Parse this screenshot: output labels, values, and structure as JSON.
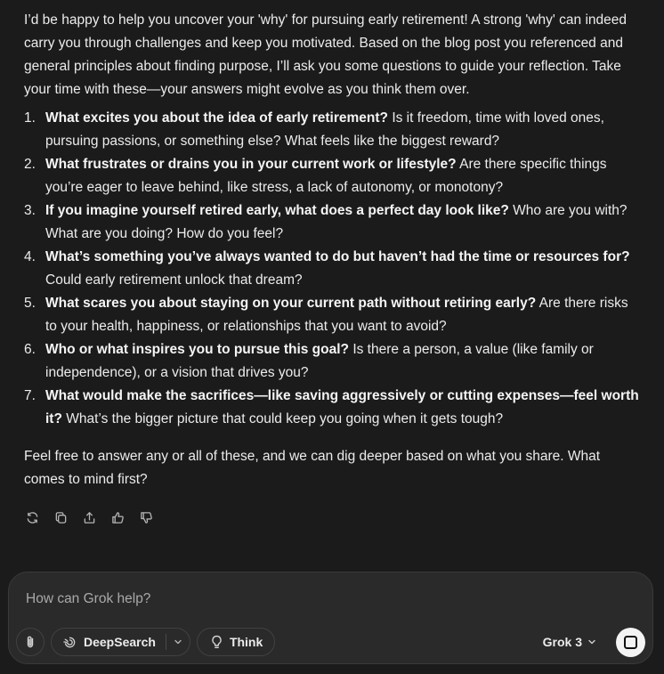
{
  "message": {
    "intro": "I’d be happy to help you uncover your 'why' for pursuing early retirement! A strong 'why' can indeed carry you through challenges and keep you motivated. Based on the blog post you referenced and general principles about finding purpose, I’ll ask you some questions to guide your reflection. Take your time with these—your answers might evolve as you think them over.",
    "questions": [
      {
        "num": "1.",
        "bold": "What excites you about the idea of early retirement?",
        "rest": " Is it freedom, time with loved ones, pursuing passions, or something else? What feels like the biggest reward?"
      },
      {
        "num": "2.",
        "bold": "What frustrates or drains you in your current work or lifestyle?",
        "rest": " Are there specific things you’re eager to leave behind, like stress, a lack of autonomy, or monotony?"
      },
      {
        "num": "3.",
        "bold": "If you imagine yourself retired early, what does a perfect day look like?",
        "rest": " Who are you with? What are you doing? How do you feel?"
      },
      {
        "num": "4.",
        "bold": "What’s something you’ve always wanted to do but haven’t had the time or resources for?",
        "rest": " Could early retirement unlock that dream?"
      },
      {
        "num": "5.",
        "bold": "What scares you about staying on your current path without retiring early?",
        "rest": " Are there risks to your health, happiness, or relationships that you want to avoid?"
      },
      {
        "num": "6.",
        "bold": "Who or what inspires you to pursue this goal?",
        "rest": " Is there a person, a value (like family or independence), or a vision that drives you?"
      },
      {
        "num": "7.",
        "bold": "What would make the sacrifices—like saving aggressively or cutting expenses—feel worth it?",
        "rest": " What’s the bigger picture that could keep you going when it gets tough?"
      }
    ],
    "outro": "Feel free to answer any or all of these, and we can dig deeper based on what you share. What comes to mind first?"
  },
  "actions": {
    "icons": [
      "regenerate-icon",
      "copy-icon",
      "share-icon",
      "thumbs-up-icon",
      "thumbs-down-icon"
    ]
  },
  "composer": {
    "placeholder": "How can Grok help?",
    "value": "",
    "deepsearch_label": "DeepSearch",
    "think_label": "Think",
    "model_label": "Grok 3"
  },
  "colors": {
    "background": "#1b1b1c",
    "composer_bg": "#2a2a2b",
    "text": "#ececec",
    "send_button": "#f4f4f4"
  }
}
